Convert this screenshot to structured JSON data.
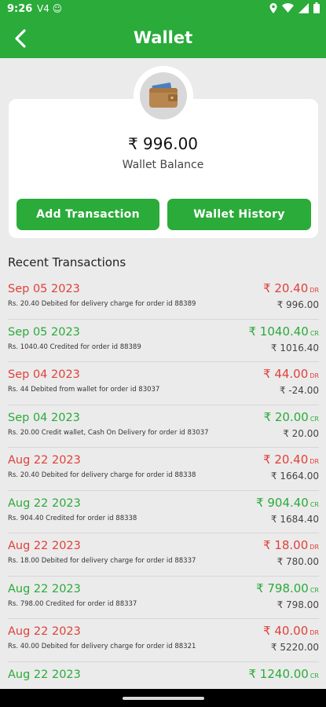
{
  "status": {
    "time": "9:26",
    "left_icons": "V4 ☺"
  },
  "header": {
    "title": "Wallet"
  },
  "wallet": {
    "balance": "₹ 996.00",
    "label": "Wallet Balance"
  },
  "buttons": {
    "add": "Add Transaction",
    "history": "Wallet History"
  },
  "section_title": "Recent Transactions",
  "colors": {
    "brand": "#2aab3a",
    "debit": "#e0413a"
  },
  "transactions": [
    {
      "date": "Sep 05 2023",
      "desc": "Rs. 20.40 Debited for delivery charge for order id 88389",
      "amount": "₹ 20.40",
      "type": "DR",
      "balance": "₹ 996.00"
    },
    {
      "date": "Sep 05 2023",
      "desc": "Rs. 1040.40 Credited for order id 88389",
      "amount": "₹ 1040.40",
      "type": "CR",
      "balance": "₹ 1016.40"
    },
    {
      "date": "Sep 04 2023",
      "desc": "Rs. 44 Debited from wallet for order id 83037",
      "amount": "₹ 44.00",
      "type": "DR",
      "balance": "₹ -24.00"
    },
    {
      "date": "Sep 04 2023",
      "desc": "Rs. 20.00 Credit wallet, Cash On Delivery for order id 83037",
      "amount": "₹ 20.00",
      "type": "CR",
      "balance": "₹ 20.00"
    },
    {
      "date": "Aug 22 2023",
      "desc": "Rs. 20.40 Debited for delivery charge for order id 88338",
      "amount": "₹ 20.40",
      "type": "DR",
      "balance": "₹ 1664.00"
    },
    {
      "date": "Aug 22 2023",
      "desc": "Rs. 904.40 Credited for order id 88338",
      "amount": "₹ 904.40",
      "type": "CR",
      "balance": "₹ 1684.40"
    },
    {
      "date": "Aug 22 2023",
      "desc": "Rs. 18.00 Debited for delivery charge for order id 88337",
      "amount": "₹ 18.00",
      "type": "DR",
      "balance": "₹ 780.00"
    },
    {
      "date": "Aug 22 2023",
      "desc": "Rs. 798.00 Credited for order id 88337",
      "amount": "₹ 798.00",
      "type": "CR",
      "balance": "₹ 798.00"
    },
    {
      "date": "Aug 22 2023",
      "desc": "Rs. 40.00 Debited for delivery charge for order id 88321",
      "amount": "₹ 40.00",
      "type": "DR",
      "balance": "₹ 5220.00"
    },
    {
      "date": "Aug 22 2023",
      "desc": "",
      "amount": "₹ 1240.00",
      "type": "CR",
      "balance": ""
    }
  ]
}
